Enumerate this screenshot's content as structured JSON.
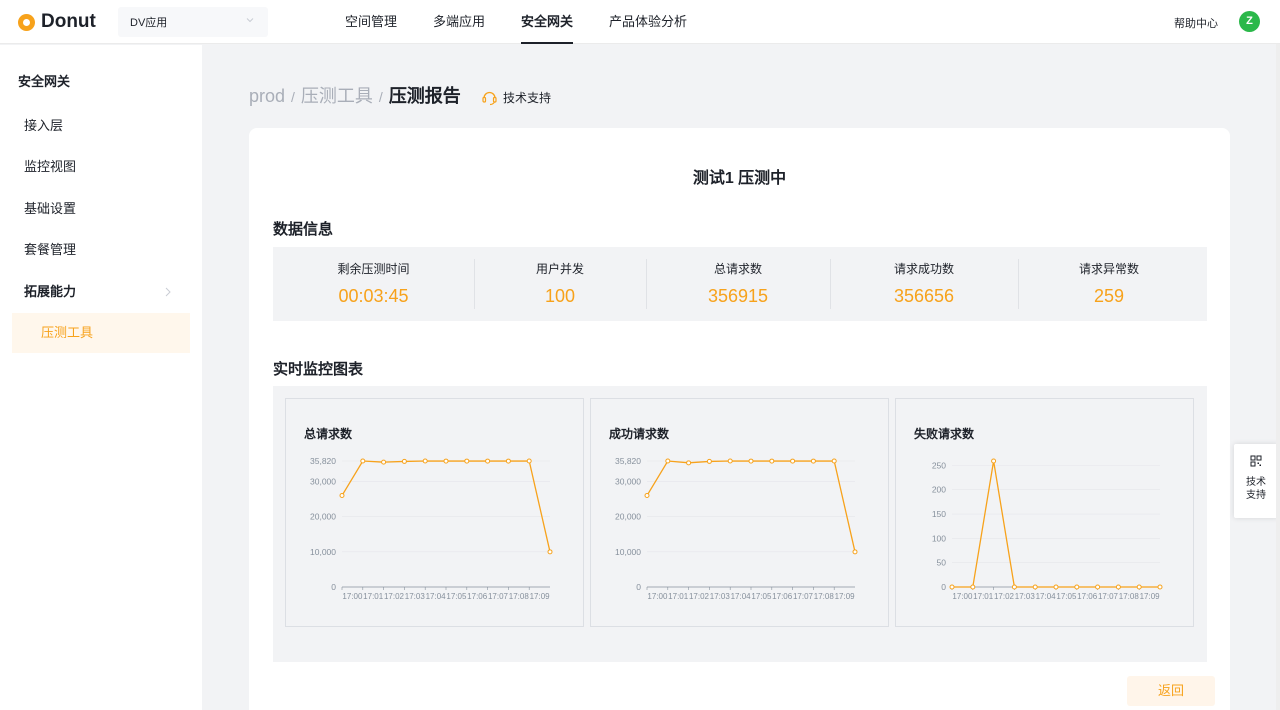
{
  "header": {
    "logo": "Donut",
    "app_select": "DV应用",
    "nav": [
      {
        "label": "空间管理",
        "active": false
      },
      {
        "label": "多端应用",
        "active": false
      },
      {
        "label": "安全网关",
        "active": true
      },
      {
        "label": "产品体验分析",
        "active": false
      }
    ],
    "help": "帮助中心",
    "avatar": "Z"
  },
  "sidebar": {
    "title": "安全网关",
    "items": [
      {
        "label": "接入层"
      },
      {
        "label": "监控视图"
      },
      {
        "label": "基础设置"
      },
      {
        "label": "套餐管理"
      },
      {
        "label": "拓展能力"
      },
      {
        "label": "压测工具"
      }
    ]
  },
  "breadcrumb": {
    "items": [
      "prod",
      "压测工具"
    ],
    "separator": "/",
    "current": "压测报告",
    "support": "技术支持"
  },
  "report": {
    "title": "测试1 压测中",
    "data_section": "数据信息",
    "stats": [
      {
        "label": "剩余压测时间",
        "value": "00:03:45"
      },
      {
        "label": "用户并发",
        "value": "100"
      },
      {
        "label": "总请求数",
        "value": "356915"
      },
      {
        "label": "请求成功数",
        "value": "356656"
      },
      {
        "label": "请求异常数",
        "value": "259"
      }
    ],
    "chart_section": "实时监控图表",
    "back": "返回"
  },
  "float_support": "技术支持",
  "colors": {
    "accent": "#f7a21b",
    "avatar": "#2bb84a"
  },
  "chart_data": [
    {
      "type": "line",
      "title": "总请求数",
      "x": [
        "17:00",
        "17:01",
        "17:02",
        "17:03",
        "17:04",
        "17:05",
        "17:06",
        "17:07",
        "17:08",
        "17:09"
      ],
      "values": [
        26000,
        35820,
        35500,
        35700,
        35820,
        35800,
        35800,
        35800,
        35800,
        35820,
        10000
      ],
      "yticks": [
        "0",
        "10,000",
        "20,000",
        "30,000",
        "35,820"
      ],
      "ylim": [
        0,
        35820
      ],
      "color": "#f7a21b"
    },
    {
      "type": "line",
      "title": "成功请求数",
      "x": [
        "17:00",
        "17:01",
        "17:02",
        "17:03",
        "17:04",
        "17:05",
        "17:06",
        "17:07",
        "17:08",
        "17:09"
      ],
      "values": [
        26000,
        35820,
        35300,
        35700,
        35820,
        35800,
        35800,
        35800,
        35800,
        35820,
        10000
      ],
      "yticks": [
        "0",
        "10,000",
        "20,000",
        "30,000",
        "35,820"
      ],
      "ylim": [
        0,
        35820
      ],
      "color": "#f7a21b"
    },
    {
      "type": "line",
      "title": "失败请求数",
      "x": [
        "17:00",
        "17:01",
        "17:02",
        "17:03",
        "17:04",
        "17:05",
        "17:06",
        "17:07",
        "17:08",
        "17:09"
      ],
      "values": [
        0,
        0,
        259,
        0,
        0,
        0,
        0,
        0,
        0,
        0,
        0
      ],
      "yticks": [
        "0",
        "50",
        "100",
        "150",
        "200",
        "250"
      ],
      "ylim": [
        0,
        259
      ],
      "color": "#f7a21b"
    }
  ]
}
